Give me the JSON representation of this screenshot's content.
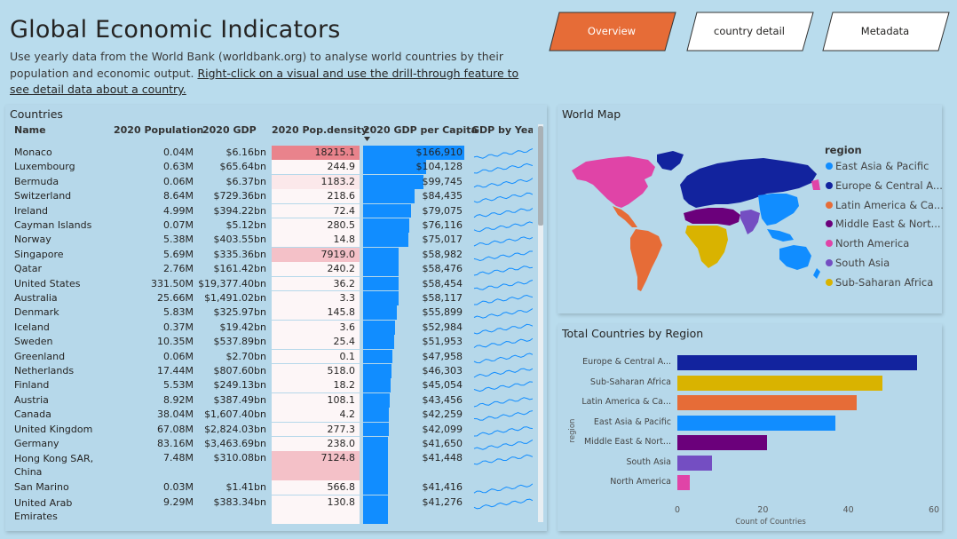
{
  "header": {
    "title": "Global Economic Indicators",
    "subtitle_plain": "Use yearly data from the World Bank (worldbank.org) to analyse world countries by their population and economic output.",
    "subtitle_link": "Right-click on a visual and use the drill-through feature to see detail data about a country."
  },
  "nav": [
    {
      "label": "Overview",
      "active": true
    },
    {
      "label": "country detail",
      "active": false
    },
    {
      "label": "Metadata",
      "active": false
    }
  ],
  "countries_panel": {
    "title": "Countries",
    "columns": [
      "Name",
      "2020 Population",
      "2020 GDP",
      "2020 Pop.density",
      "2020 GDP per Capita",
      "GDP by Year"
    ],
    "sort_column": "2020 GDP per Capita",
    "rows": [
      {
        "name": "Monaco",
        "pop": "0.04M",
        "gdp": "$6.16bn",
        "density": "18215.1",
        "density_val": 18215.1,
        "gdppc": "$166,910",
        "gdppc_val": 166910
      },
      {
        "name": "Luxembourg",
        "pop": "0.63M",
        "gdp": "$65.64bn",
        "density": "244.9",
        "density_val": 244.9,
        "gdppc": "$104,128",
        "gdppc_val": 104128
      },
      {
        "name": "Bermuda",
        "pop": "0.06M",
        "gdp": "$6.37bn",
        "density": "1183.2",
        "density_val": 1183.2,
        "gdppc": "$99,745",
        "gdppc_val": 99745
      },
      {
        "name": "Switzerland",
        "pop": "8.64M",
        "gdp": "$729.36bn",
        "density": "218.6",
        "density_val": 218.6,
        "gdppc": "$84,435",
        "gdppc_val": 84435
      },
      {
        "name": "Ireland",
        "pop": "4.99M",
        "gdp": "$394.22bn",
        "density": "72.4",
        "density_val": 72.4,
        "gdppc": "$79,075",
        "gdppc_val": 79075
      },
      {
        "name": "Cayman Islands",
        "pop": "0.07M",
        "gdp": "$5.12bn",
        "density": "280.5",
        "density_val": 280.5,
        "gdppc": "$76,116",
        "gdppc_val": 76116
      },
      {
        "name": "Norway",
        "pop": "5.38M",
        "gdp": "$403.55bn",
        "density": "14.8",
        "density_val": 14.8,
        "gdppc": "$75,017",
        "gdppc_val": 75017
      },
      {
        "name": "Singapore",
        "pop": "5.69M",
        "gdp": "$335.36bn",
        "density": "7919.0",
        "density_val": 7919.0,
        "gdppc": "$58,982",
        "gdppc_val": 58982
      },
      {
        "name": "Qatar",
        "pop": "2.76M",
        "gdp": "$161.42bn",
        "density": "240.2",
        "density_val": 240.2,
        "gdppc": "$58,476",
        "gdppc_val": 58476
      },
      {
        "name": "United States",
        "pop": "331.50M",
        "gdp": "$19,377.40bn",
        "density": "36.2",
        "density_val": 36.2,
        "gdppc": "$58,454",
        "gdppc_val": 58454
      },
      {
        "name": "Australia",
        "pop": "25.66M",
        "gdp": "$1,491.02bn",
        "density": "3.3",
        "density_val": 3.3,
        "gdppc": "$58,117",
        "gdppc_val": 58117
      },
      {
        "name": "Denmark",
        "pop": "5.83M",
        "gdp": "$325.97bn",
        "density": "145.8",
        "density_val": 145.8,
        "gdppc": "$55,899",
        "gdppc_val": 55899
      },
      {
        "name": "Iceland",
        "pop": "0.37M",
        "gdp": "$19.42bn",
        "density": "3.6",
        "density_val": 3.6,
        "gdppc": "$52,984",
        "gdppc_val": 52984
      },
      {
        "name": "Sweden",
        "pop": "10.35M",
        "gdp": "$537.89bn",
        "density": "25.4",
        "density_val": 25.4,
        "gdppc": "$51,953",
        "gdppc_val": 51953
      },
      {
        "name": "Greenland",
        "pop": "0.06M",
        "gdp": "$2.70bn",
        "density": "0.1",
        "density_val": 0.1,
        "gdppc": "$47,958",
        "gdppc_val": 47958
      },
      {
        "name": "Netherlands",
        "pop": "17.44M",
        "gdp": "$807.60bn",
        "density": "518.0",
        "density_val": 518.0,
        "gdppc": "$46,303",
        "gdppc_val": 46303
      },
      {
        "name": "Finland",
        "pop": "5.53M",
        "gdp": "$249.13bn",
        "density": "18.2",
        "density_val": 18.2,
        "gdppc": "$45,054",
        "gdppc_val": 45054
      },
      {
        "name": "Austria",
        "pop": "8.92M",
        "gdp": "$387.49bn",
        "density": "108.1",
        "density_val": 108.1,
        "gdppc": "$43,456",
        "gdppc_val": 43456
      },
      {
        "name": "Canada",
        "pop": "38.04M",
        "gdp": "$1,607.40bn",
        "density": "4.2",
        "density_val": 4.2,
        "gdppc": "$42,259",
        "gdppc_val": 42259
      },
      {
        "name": "United Kingdom",
        "pop": "67.08M",
        "gdp": "$2,824.03bn",
        "density": "277.3",
        "density_val": 277.3,
        "gdppc": "$42,099",
        "gdppc_val": 42099
      },
      {
        "name": "Germany",
        "pop": "83.16M",
        "gdp": "$3,463.69bn",
        "density": "238.0",
        "density_val": 238.0,
        "gdppc": "$41,650",
        "gdppc_val": 41650
      },
      {
        "name": "Hong Kong SAR, China",
        "pop": "7.48M",
        "gdp": "$310.08bn",
        "density": "7124.8",
        "density_val": 7124.8,
        "gdppc": "$41,448",
        "gdppc_val": 41448,
        "tall": true
      },
      {
        "name": "San Marino",
        "pop": "0.03M",
        "gdp": "$1.41bn",
        "density": "566.8",
        "density_val": 566.8,
        "gdppc": "$41,416",
        "gdppc_val": 41416
      },
      {
        "name": "United Arab Emirates",
        "pop": "9.29M",
        "gdp": "$383.34bn",
        "density": "130.8",
        "density_val": 130.8,
        "gdppc": "$41,276",
        "gdppc_val": 41276,
        "tall": true
      }
    ]
  },
  "map_panel": {
    "title": "World Map",
    "legend_title": "region",
    "legend": [
      {
        "label": "East Asia & Pacific",
        "color": "#118dff"
      },
      {
        "label": "Europe & Central A...",
        "color": "#12239e"
      },
      {
        "label": "Latin America & Ca...",
        "color": "#e66c37"
      },
      {
        "label": "Middle East & Nort...",
        "color": "#6b007b"
      },
      {
        "label": "North America",
        "color": "#e044a7"
      },
      {
        "label": "South Asia",
        "color": "#744ec2"
      },
      {
        "label": "Sub-Saharan Africa",
        "color": "#d9b300"
      }
    ]
  },
  "region_panel": {
    "title": "Total Countries by Region"
  },
  "chart_data": {
    "type": "bar",
    "orientation": "horizontal",
    "title": "Total Countries by Region",
    "xlabel": "Count of Countries",
    "ylabel": "region",
    "xlim": [
      0,
      60
    ],
    "xticks": [
      0,
      20,
      40,
      60
    ],
    "grid": false,
    "categories": [
      "Europe & Central A...",
      "Sub-Saharan Africa",
      "Latin America & Ca...",
      "East Asia & Pacific",
      "Middle East & Nort...",
      "South Asia",
      "North America"
    ],
    "values": [
      56,
      48,
      42,
      37,
      21,
      8,
      3
    ],
    "colors": [
      "#12239e",
      "#d9b300",
      "#e66c37",
      "#118dff",
      "#6b007b",
      "#744ec2",
      "#e044a7"
    ]
  }
}
